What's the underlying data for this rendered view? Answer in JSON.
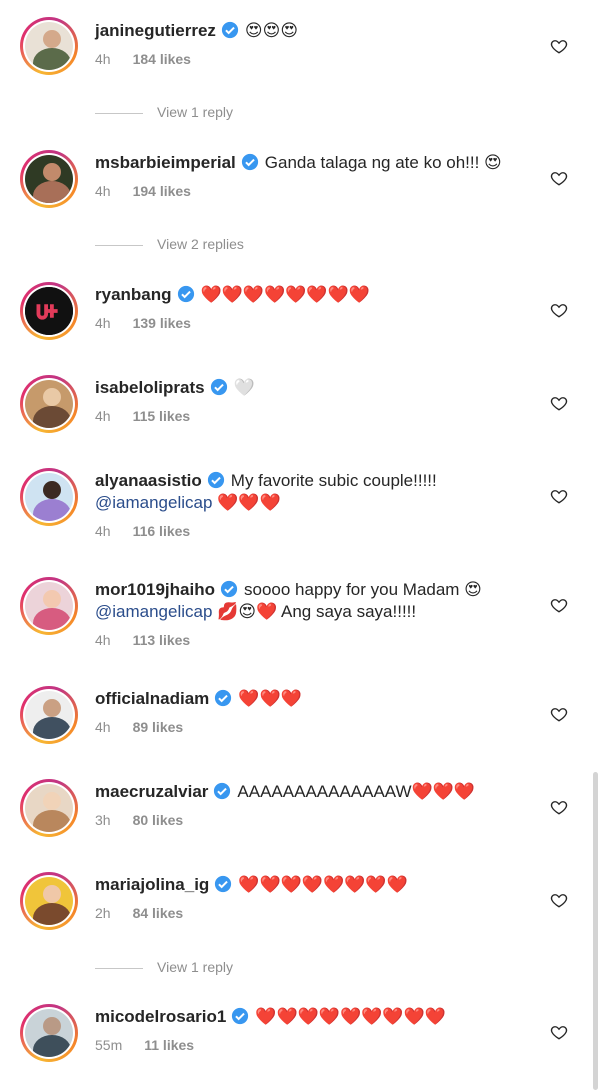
{
  "comments": [
    {
      "user": "janinegutierrez",
      "text": "😍😍😍",
      "mention": "",
      "extra": "",
      "time": "4h",
      "likes": "184 likes",
      "av1": "#e9e1d6",
      "av2": "#5b6b4a"
    },
    {
      "user": "msbarbieimperial",
      "text": "Ganda talaga ng ate ko oh!!! 😍",
      "mention": "",
      "extra": "",
      "time": "4h",
      "likes": "194 likes",
      "av1": "#2f3a24",
      "av2": "#a86f58"
    },
    {
      "user": "ryanbang",
      "text": "❤️❤️❤️❤️❤️❤️❤️❤️",
      "mention": "",
      "extra": "",
      "time": "4h",
      "likes": "139 likes",
      "av1": "#111111",
      "av2": "#e23b5a"
    },
    {
      "user": "isabeloliprats",
      "text": "🤍",
      "mention": "",
      "extra": "",
      "time": "4h",
      "likes": "115 likes",
      "av1": "#c69a6b",
      "av2": "#6b4a35"
    },
    {
      "user": "alyanaasistio",
      "text": "My favorite subic couple!!!!!",
      "mention": "@iamangelicap",
      "extra": " ❤️❤️❤️",
      "time": "4h",
      "likes": "116 likes",
      "av1": "#cfe3f2",
      "av2": "#9b7fd1"
    },
    {
      "user": "mor1019jhaiho",
      "text": "soooo happy for you Madam 😍",
      "mention": "@iamangelicap",
      "extra": " 💋😍❤️ Ang saya saya!!!!!",
      "time": "4h",
      "likes": "113 likes",
      "av1": "#ecd3d9",
      "av2": "#d75c80"
    },
    {
      "user": "officialnadiam",
      "text": "❤️❤️❤️",
      "mention": "",
      "extra": "",
      "time": "4h",
      "likes": "89 likes",
      "av1": "#eeeeee",
      "av2": "#405060"
    },
    {
      "user": "maecruzalviar",
      "text": "AAAAAAAAAAAAAAW❤️❤️❤️",
      "mention": "",
      "extra": "",
      "time": "3h",
      "likes": "80 likes",
      "av1": "#e8d7c5",
      "av2": "#b9875d"
    },
    {
      "user": "mariajolina_ig",
      "text": "❤️❤️❤️❤️❤️❤️❤️❤️",
      "mention": "",
      "extra": "",
      "time": "2h",
      "likes": "84 likes",
      "av1": "#f0c53a",
      "av2": "#7a4a2d"
    },
    {
      "user": "micodelrosario1",
      "text": "❤️❤️❤️❤️❤️❤️❤️❤️❤️",
      "mention": "",
      "extra": "",
      "time": "55m",
      "likes": "11 likes",
      "av1": "#c9d3d8",
      "av2": "#3e4f5b"
    }
  ],
  "replies": [
    "View 1 reply",
    "View 2 replies",
    "View 1 reply"
  ],
  "colors": {
    "verified": "#3897f0",
    "heart_outline": "#262626",
    "meta": "#8e8e8e"
  }
}
